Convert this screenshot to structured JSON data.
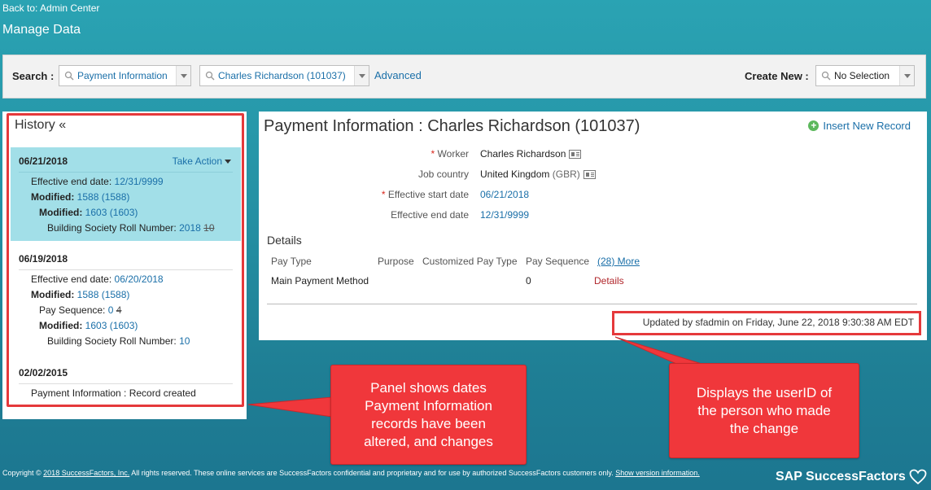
{
  "header": {
    "back_link": "Back to: Admin Center",
    "title": "Manage Data"
  },
  "search_bar": {
    "search_label": "Search :",
    "object_type": "Payment Information",
    "record": "Charles Richardson (101037)",
    "advanced": "Advanced",
    "create_new_label": "Create New :",
    "create_new_value": "No Selection"
  },
  "history": {
    "title": "History «",
    "take_action": "Take Action",
    "entries": [
      {
        "date": "06/21/2018",
        "effective_end_label": "Effective end date:",
        "effective_end_value": "12/31/9999",
        "modified_label": "Modified:",
        "modified_value": "1588 (1588)",
        "sub_modified_label": "Modified:",
        "sub_modified_value": "1603 (1603)",
        "roll_label": "Building Society Roll Number:",
        "roll_new": "2018",
        "roll_old": "10"
      },
      {
        "date": "06/19/2018",
        "effective_end_label": "Effective end date:",
        "effective_end_value": "06/20/2018",
        "modified_label": "Modified:",
        "modified_value": "1588 (1588)",
        "pay_seq_label": "Pay Sequence:",
        "pay_seq_new": "0",
        "pay_seq_old": "4",
        "sub_modified_label": "Modified:",
        "sub_modified_value": "1603 (1603)",
        "roll_label": "Building Society Roll Number:",
        "roll_value": "10"
      },
      {
        "date": "02/02/2015",
        "line": "Payment Information : Record created"
      }
    ]
  },
  "main": {
    "title": "Payment Information : Charles Richardson (101037)",
    "insert_new": "Insert New Record",
    "fields": {
      "worker_label": "Worker",
      "worker_value": "Charles Richardson",
      "country_label": "Job country",
      "country_value": "United Kingdom",
      "country_code": "(GBR)",
      "start_label": "Effective start date",
      "start_value": "06/21/2018",
      "end_label": "Effective end date",
      "end_value": "12/31/9999",
      "required_mark": "*"
    },
    "details": {
      "title": "Details",
      "columns": [
        "Pay Type",
        "Purpose",
        "Customized Pay Type",
        "Pay Sequence"
      ],
      "more": "(28) More",
      "row": {
        "pay_type": "Main Payment Method",
        "purpose": "",
        "customized_pay_type": "",
        "pay_sequence": "0",
        "details_link": "Details"
      }
    },
    "updated_by": "Updated by sfadmin on Friday, June 22, 2018 9:30:38 AM EDT"
  },
  "callouts": {
    "left": "Panel shows dates Payment Information records have been altered, and changes",
    "right": "Displays the userID of the person who made the change"
  },
  "footer": {
    "copyright_prefix": "Copyright ©",
    "company_link": "2018 SuccessFactors, Inc.",
    "copyright_text": "All rights reserved. These online services are SuccessFactors confidential and proprietary and for use by authorized SuccessFactors customers only.",
    "show_version": "Show version information.",
    "brand": "SAP SuccessFactors"
  },
  "colors": {
    "background_top": "#2aa3b3",
    "background_bottom": "#1c7690",
    "highlight_red": "#e5393b",
    "link_blue": "#1a6fa8",
    "history_selected": "#a2dfe8"
  },
  "icons": [
    "search-icon",
    "dropdown-arrow-icon",
    "card-icon",
    "plus-icon",
    "heart-icon"
  ]
}
